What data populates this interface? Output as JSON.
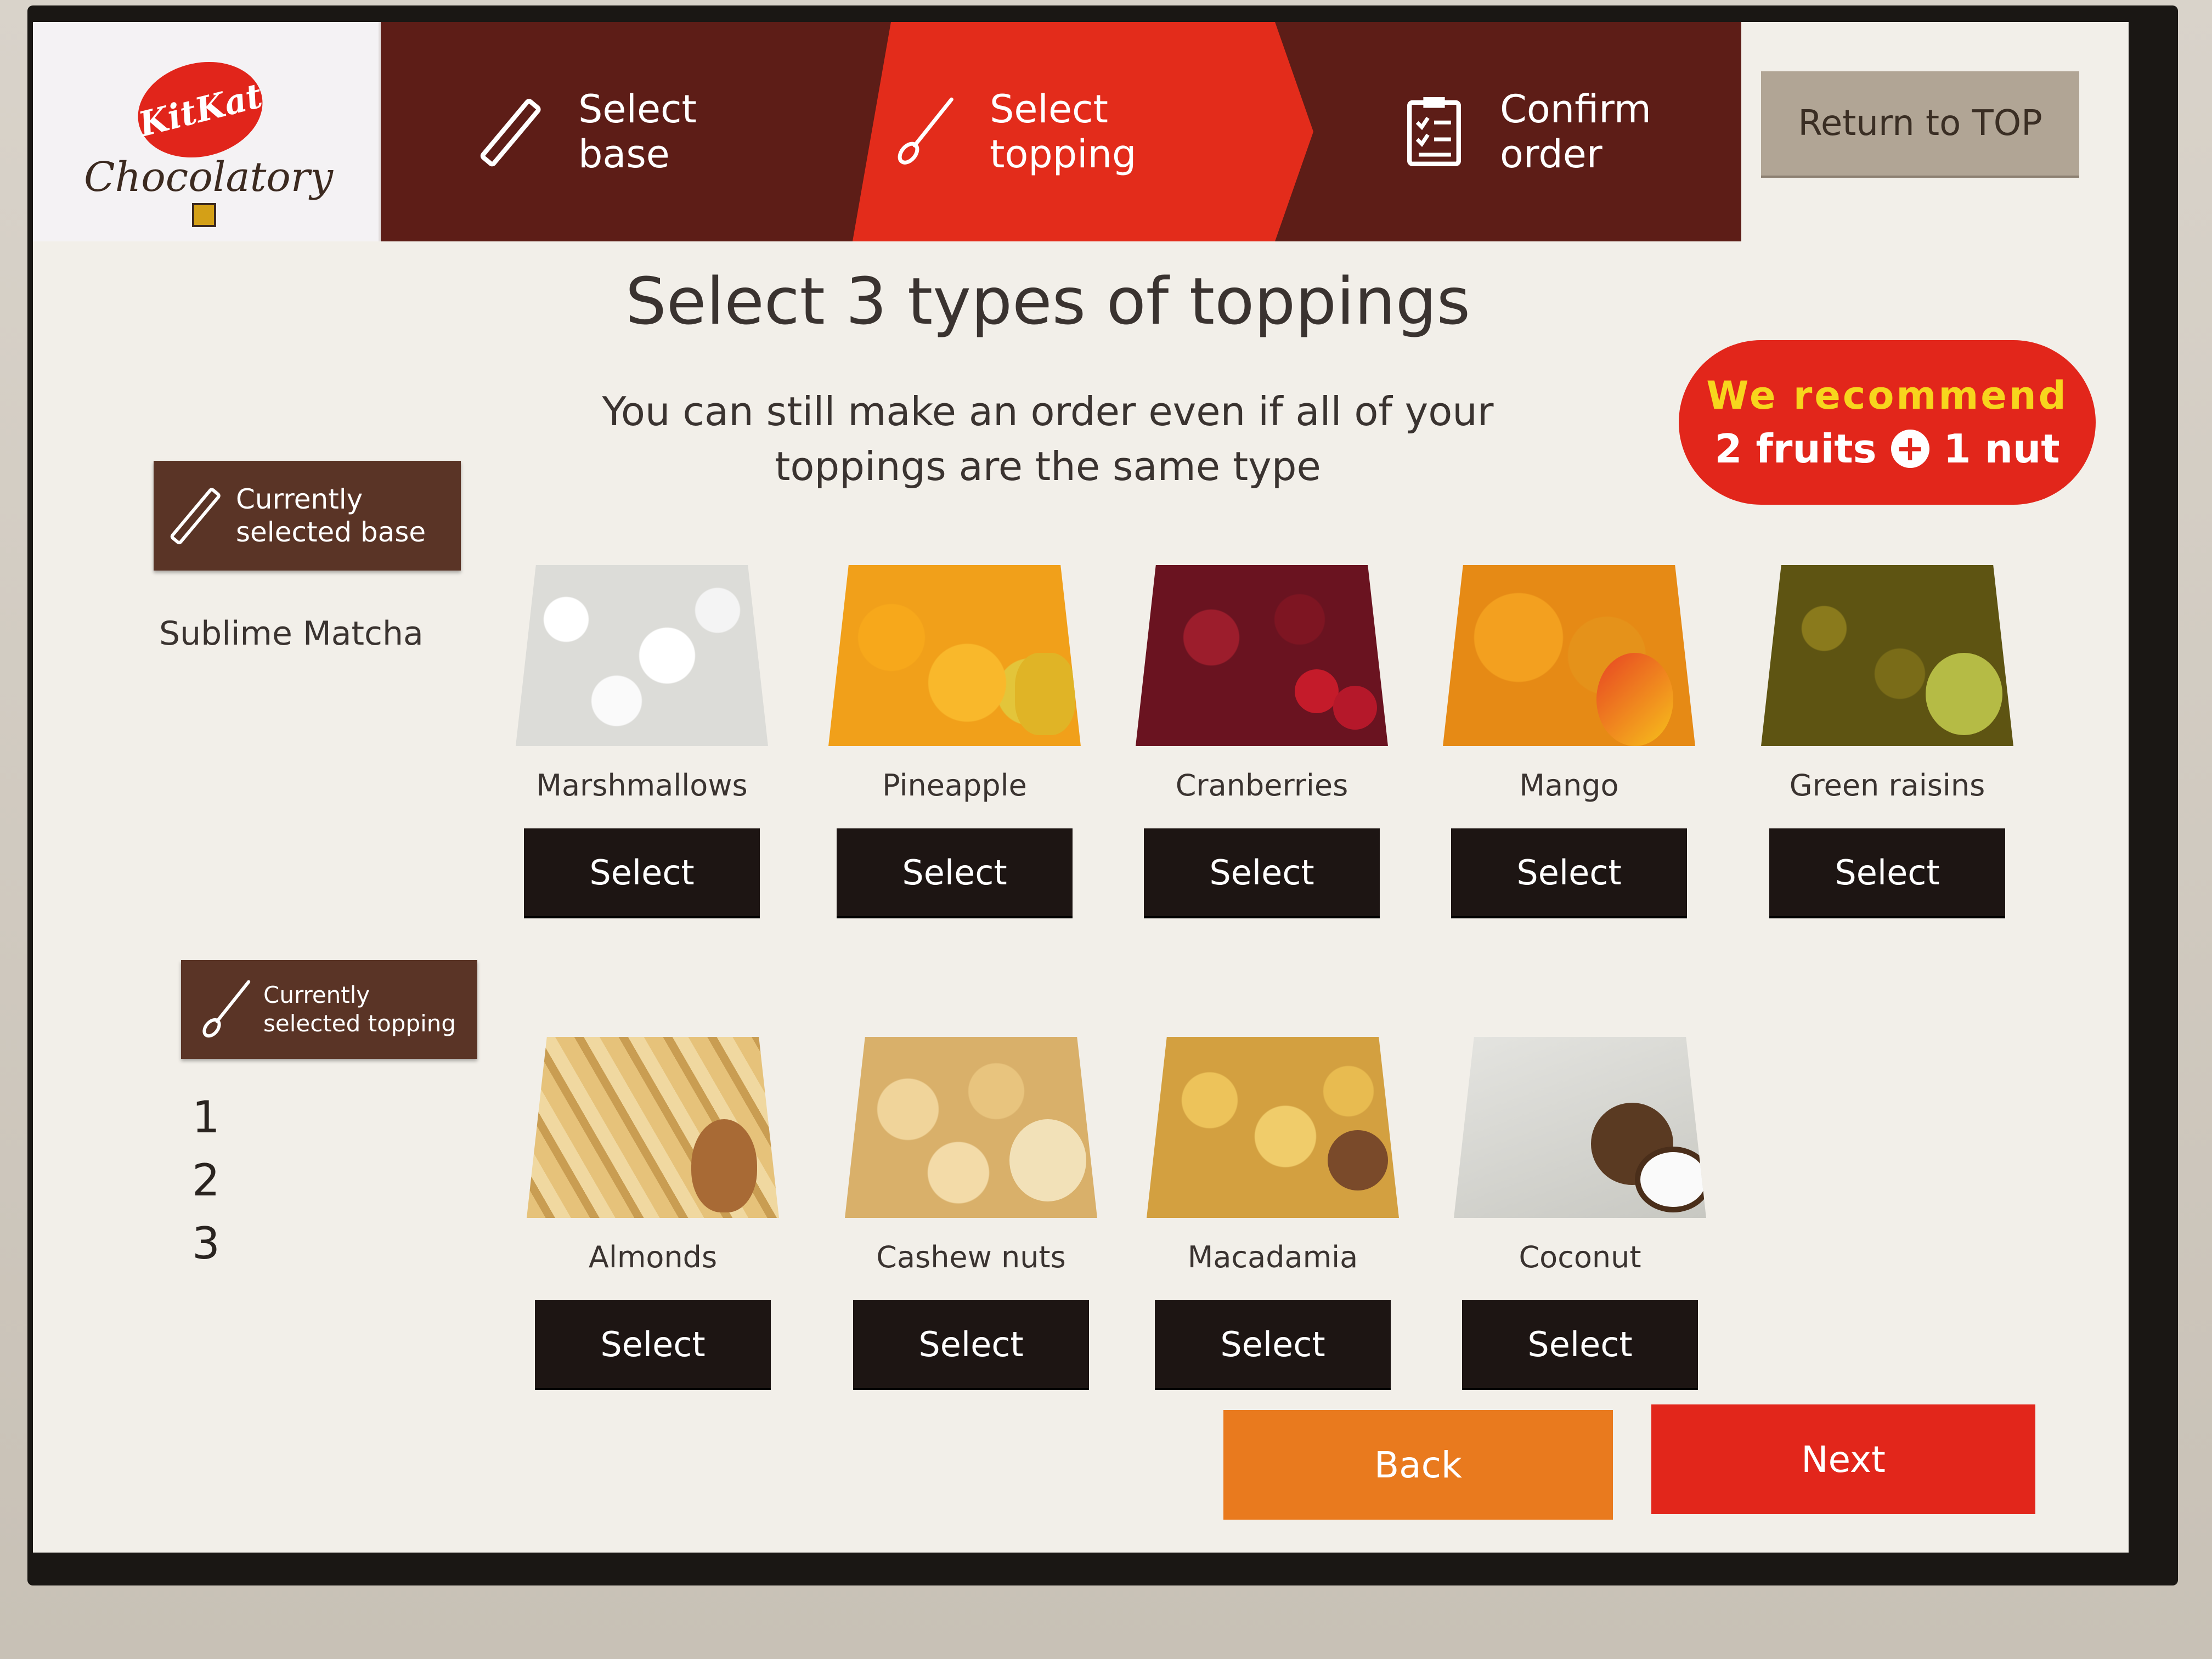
{
  "brand": {
    "logo_text": "KitKat",
    "sub_brand": "Chocolatory"
  },
  "steps": [
    {
      "label": "Select\nbase",
      "icon": "stick-icon",
      "state": "done"
    },
    {
      "label": "Select\ntopping",
      "icon": "spoon-icon",
      "state": "active"
    },
    {
      "label": "Confirm\norder",
      "icon": "checklist-icon",
      "state": "pending"
    }
  ],
  "header": {
    "return_label": "Return to TOP"
  },
  "main": {
    "title": "Select 3 types of toppings",
    "subtitle": "You can still make an order even if all of your toppings are the same type"
  },
  "recommend": {
    "line1": "We recommend",
    "fruits": "2 fruits",
    "nuts": "1 nut"
  },
  "sidebar": {
    "base_tag": "Currently\nselected base",
    "base_value": "Sublime Matcha",
    "topping_tag": "Currently\nselected topping",
    "slots": [
      "1",
      "2",
      "3"
    ]
  },
  "toppings": [
    {
      "name": "Marshmallows",
      "select_label": "Select"
    },
    {
      "name": "Pineapple",
      "select_label": "Select"
    },
    {
      "name": "Cranberries",
      "select_label": "Select"
    },
    {
      "name": "Mango",
      "select_label": "Select"
    },
    {
      "name": "Green raisins",
      "select_label": "Select"
    },
    {
      "name": "Almonds",
      "select_label": "Select"
    },
    {
      "name": "Cashew nuts",
      "select_label": "Select"
    },
    {
      "name": "Macadamia",
      "select_label": "Select"
    },
    {
      "name": "Coconut",
      "select_label": "Select"
    }
  ],
  "footer": {
    "back_label": "Back",
    "next_label": "Next"
  },
  "colors": {
    "header_dark": "#5d1d17",
    "active_red": "#e32c1b",
    "back_orange": "#e97a1e",
    "next_red": "#e2261b",
    "select_button": "#1d1513"
  }
}
